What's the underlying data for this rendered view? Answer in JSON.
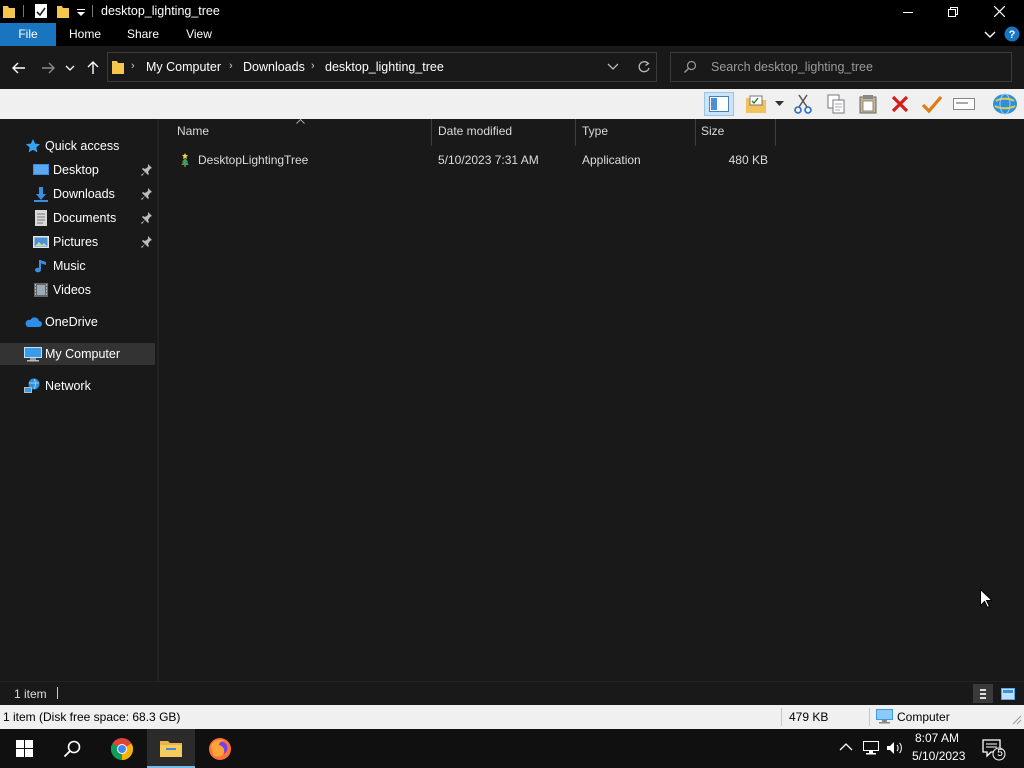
{
  "window": {
    "title": "desktop_lighting_tree",
    "controls": {
      "minimize_icon": "minimize-icon",
      "restore_icon": "restore-icon",
      "close_icon": "close-icon"
    }
  },
  "ribbon": {
    "tabs": [
      "File",
      "Home",
      "Share",
      "View"
    ],
    "active_tab": "File",
    "accent": "#1a75c0"
  },
  "address": {
    "breadcrumbs": [
      "My Computer",
      "Downloads",
      "desktop_lighting_tree"
    ],
    "search_placeholder": "Search desktop_lighting_tree"
  },
  "toolbar": {
    "buttons": [
      "preview-pane",
      "properties-dropdown",
      "cut",
      "copy",
      "paste",
      "delete",
      "rename",
      "select",
      "network"
    ]
  },
  "navigation": {
    "quick_access": "Quick access",
    "pinned": [
      {
        "label": "Desktop",
        "pinned": true
      },
      {
        "label": "Downloads",
        "pinned": true
      },
      {
        "label": "Documents",
        "pinned": true
      },
      {
        "label": "Pictures",
        "pinned": true
      },
      {
        "label": "Music",
        "pinned": false
      },
      {
        "label": "Videos",
        "pinned": false
      }
    ],
    "onedrive": "OneDrive",
    "my_computer": "My Computer",
    "network": "Network",
    "selected": "My Computer"
  },
  "file_list": {
    "columns": [
      "Name",
      "Date modified",
      "Type",
      "Size"
    ],
    "sort_column": "Name",
    "rows": [
      {
        "name": "DesktopLightingTree",
        "date_modified": "5/10/2023 7:31 AM",
        "type": "Application",
        "size": "480 KB"
      }
    ]
  },
  "status": {
    "item_count": "1 item",
    "details_left": "1 item (Disk free space: 68.3 GB)",
    "details_size": "479 KB",
    "details_location": "Computer"
  },
  "taskbar": {
    "apps": [
      "start",
      "search",
      "chrome",
      "file-explorer",
      "firefox"
    ],
    "active_app": "file-explorer",
    "clock_time": "8:07 AM",
    "clock_date": "5/10/2023",
    "notification_count": "5"
  }
}
